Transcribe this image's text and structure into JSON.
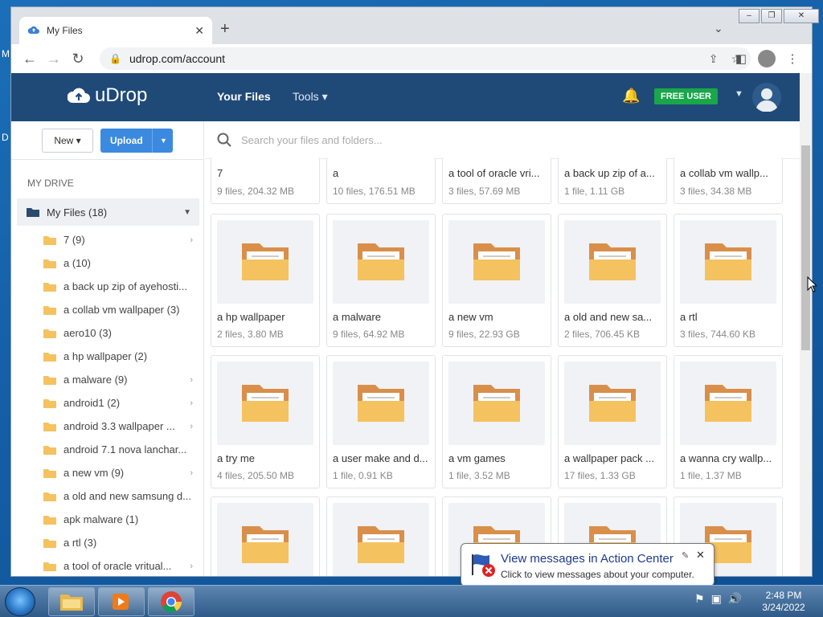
{
  "desktop": {
    "letters": [
      "M",
      "D"
    ]
  },
  "browser": {
    "tab_title": "My Files",
    "url": "udrop.com/account",
    "window_controls": {
      "minimize": "–",
      "restore": "❐",
      "close": "✕"
    }
  },
  "site": {
    "logo_text": "uDrop",
    "nav_files": "Your Files",
    "nav_tools": "Tools ▾",
    "plan_badge": "FREE USER",
    "colors": {
      "nav_bg": "#1f4a78",
      "plan_badge": "#1aa64a",
      "upload_btn": "#3b8ae0",
      "folder": "#f5c260"
    }
  },
  "sidebar": {
    "new_label": "New ▾",
    "upload_label": "Upload",
    "heading": "MY DRIVE",
    "root_label": "My Files (18)",
    "items": [
      {
        "label": "7 (9)",
        "has_children": true
      },
      {
        "label": "a (10)",
        "has_children": false
      },
      {
        "label": "a back up zip of ayehosti...",
        "has_children": false
      },
      {
        "label": "a collab vm wallpaper (3)",
        "has_children": false
      },
      {
        "label": "aero10 (3)",
        "has_children": false
      },
      {
        "label": "a hp wallpaper (2)",
        "has_children": false
      },
      {
        "label": "a malware (9)",
        "has_children": true
      },
      {
        "label": "android1 (2)",
        "has_children": true
      },
      {
        "label": "android 3.3 wallpaper ...",
        "has_children": true
      },
      {
        "label": "android 7.1 nova lanchar...",
        "has_children": false
      },
      {
        "label": "a new vm (9)",
        "has_children": true
      },
      {
        "label": "a old and new samsung d...",
        "has_children": false
      },
      {
        "label": "apk malware (1)",
        "has_children": false
      },
      {
        "label": "a rtl (3)",
        "has_children": false
      },
      {
        "label": "a tool of oracle vritual...",
        "has_children": true
      }
    ]
  },
  "search": {
    "placeholder": "Search your files and folders..."
  },
  "folders_row0": [
    {
      "name": "7",
      "meta": "9 files, 204.32 MB"
    },
    {
      "name": "a",
      "meta": "10 files, 176.51 MB"
    },
    {
      "name": "a tool of oracle vri...",
      "meta": "3 files, 57.69 MB"
    },
    {
      "name": "a back up zip of a...",
      "meta": "1 file, 1.11 GB"
    },
    {
      "name": "a collab vm wallp...",
      "meta": "3 files, 34.38 MB"
    }
  ],
  "folders_row1": [
    {
      "name": "a hp wallpaper",
      "meta": "2 files, 3.80 MB"
    },
    {
      "name": "a malware",
      "meta": "9 files, 64.92 MB"
    },
    {
      "name": "a new vm",
      "meta": "9 files, 22.93 GB"
    },
    {
      "name": "a old and new sa...",
      "meta": "2 files, 706.45 KB"
    },
    {
      "name": "a rtl",
      "meta": "3 files, 744.60 KB"
    }
  ],
  "folders_row2": [
    {
      "name": "a try me",
      "meta": "4 files, 205.50 MB"
    },
    {
      "name": "a user make and d...",
      "meta": "1 file, 0.91 KB"
    },
    {
      "name": "a vm games",
      "meta": "1 file, 3.52 MB"
    },
    {
      "name": "a wallpaper pack ...",
      "meta": "17 files, 1.33 GB"
    },
    {
      "name": "a wanna cry wallp...",
      "meta": "1 file, 1.37 MB"
    }
  ],
  "notification": {
    "title": "View messages in Action Center",
    "text": "Click to view messages about your computer."
  },
  "clock": {
    "time": "2:48 PM",
    "date": "3/24/2022"
  }
}
